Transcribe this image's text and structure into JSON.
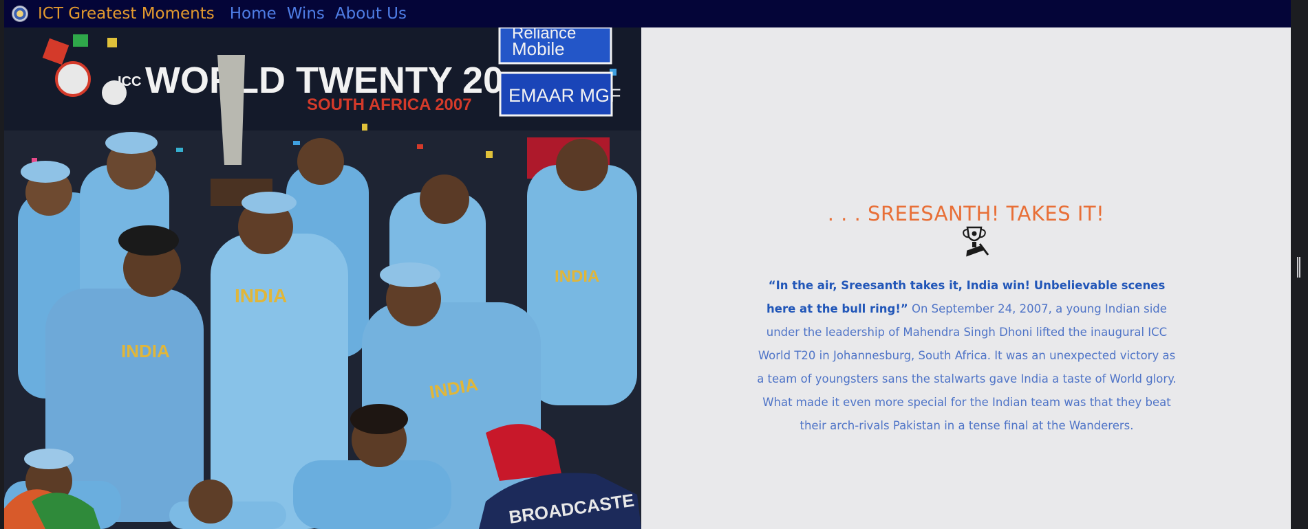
{
  "navbar": {
    "brand": "ICT Greatest Moments",
    "links": [
      "Home",
      "Wins",
      "About Us"
    ]
  },
  "hero": {
    "banner_text": "WORLD TWENTY 20",
    "banner_subtext": "SOUTH AFRICA 2007",
    "sponsor_1_line1": "Reliance",
    "sponsor_1_line2": "Mobile",
    "sponsor_2": "EMAAR MGF",
    "flag_text": "BROADCASTE"
  },
  "content": {
    "headline": ". . . SREESANTH! TAKES IT!",
    "icon": "trophy-icon",
    "quote": "“In the air, Sreesanth takes it, India win! Unbelievable scenes here at the bull ring!”",
    "body": "On September 24, 2007, a young Indian side under the leadership of Mahendra Singh Dhoni lifted the inaugural ICC World T20 in Johannesburg, South Africa. It was an unexpected victory as a team of youngsters sans the stalwarts gave India a taste of World glory. What made it even more special for the Indian team was that they beat their arch-rivals Pakistan in a tense final at the Wanderers."
  },
  "colors": {
    "navbar_bg": "#040538",
    "brand": "#e39a2e",
    "nav_link": "#4f7ee6",
    "headline": "#e86f37",
    "quote": "#2156b8",
    "body_text": "#4f74c7",
    "content_bg": "#e9e9eb"
  }
}
